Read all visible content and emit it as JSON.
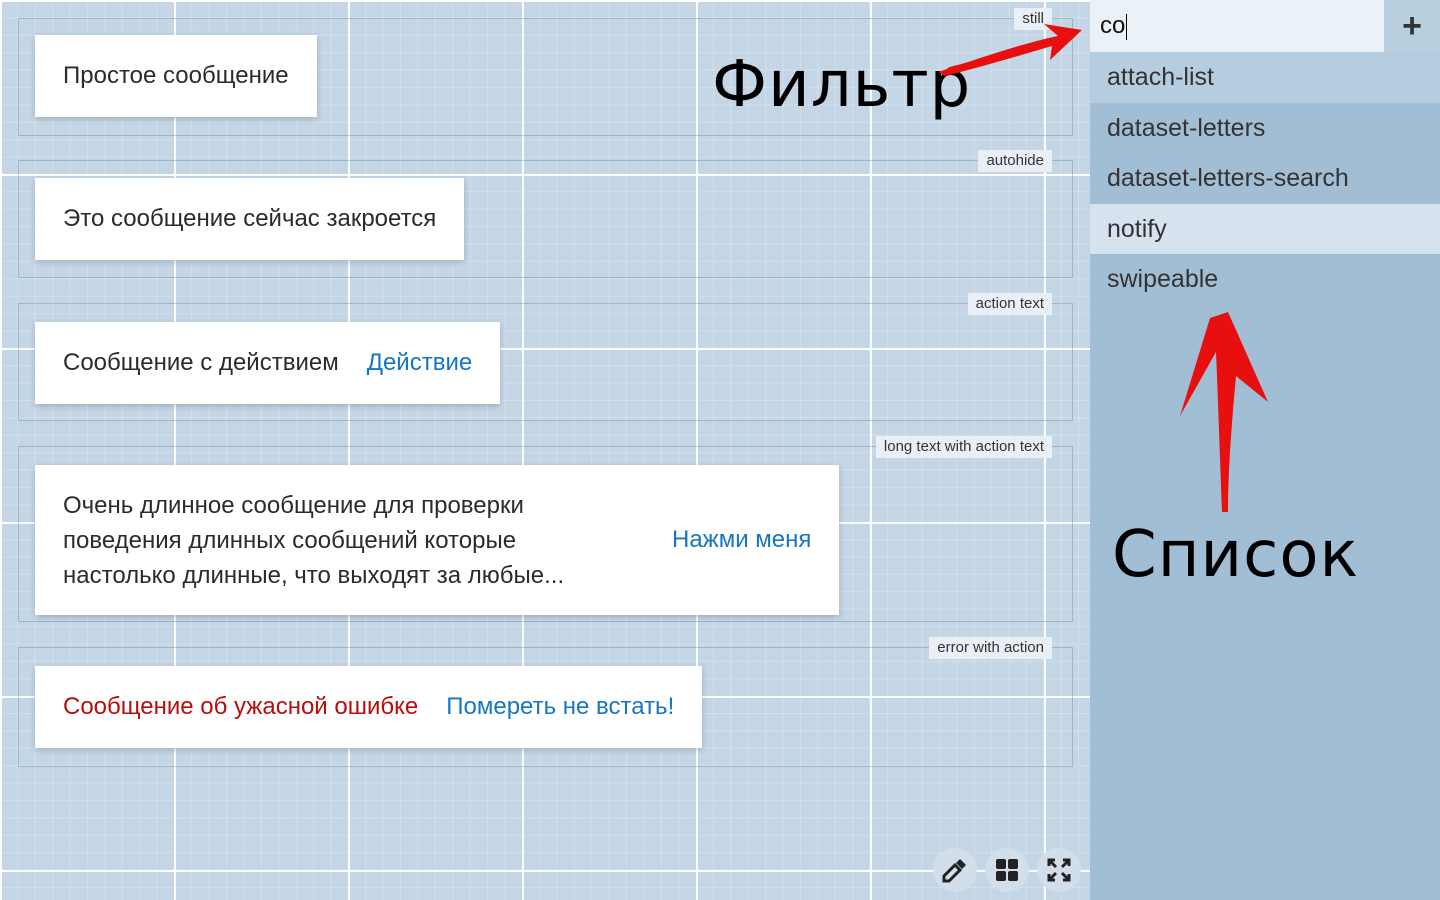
{
  "canvas": {
    "cases": [
      {
        "label": "still",
        "message": "Простое сообщение",
        "action": ""
      },
      {
        "label": "autohide",
        "message": "Это сообщение сейчас закроется",
        "action": ""
      },
      {
        "label": "action text",
        "message": "Сообщение с действием",
        "action": "Действие"
      },
      {
        "label": "long text with action text",
        "message": "Очень длинное сообщение для проверки поведения длинных сообщений которые настолько длинные, что выходят за любые...",
        "action": "Нажми меня"
      },
      {
        "label": "error with action",
        "message": "Сообщение об ужасной ошибке",
        "action": "Помереть не встать!"
      }
    ],
    "tools": [
      {
        "icon": "eyedropper-icon"
      },
      {
        "icon": "grid-icon"
      },
      {
        "icon": "fullscreen-icon"
      }
    ]
  },
  "sidebar": {
    "filter": {
      "value": "co",
      "add_label": "+"
    },
    "items": [
      "attach-list",
      "dataset-letters",
      "dataset-letters-search",
      "notify",
      "swipeable"
    ]
  },
  "annotations": {
    "filter": "Фильтр",
    "list": "Список"
  },
  "colors": {
    "canvas_bg": "#c4d6e5",
    "sidebar_bg": "#a2bed5",
    "action_link": "#1576c4",
    "error_text": "#b80d0d",
    "arrow": "#e8100f"
  }
}
